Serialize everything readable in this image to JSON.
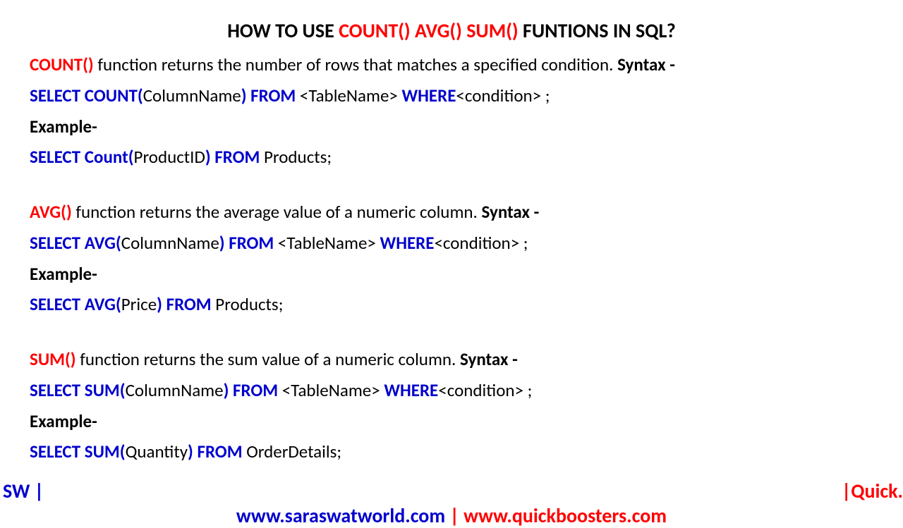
{
  "title": {
    "pre": "HOW TO USE ",
    "mid": "COUNT() AVG() SUM()",
    "post": " FUNTIONS IN SQL?"
  },
  "sections": {
    "count": {
      "fn": "COUNT()",
      "descPre": " function returns the number of rows that matches a specified condition. ",
      "syntaxLabel": "Syntax -",
      "select": "SELECT  ",
      "fnName": "COUNT(",
      "col": "ColumnName",
      "close": ")",
      "from": " FROM",
      "table": " <TableName> ",
      "where": "WHERE",
      "cond": "<condition>  ;",
      "exampleLabel": "Example-",
      "exSelect": "SELECT  ",
      "exFn": "Count(",
      "exCol": "ProductID",
      "exClose": ")",
      "exFrom": " FROM",
      "exRest": " Products;"
    },
    "avg": {
      "fn": "AVG()",
      "descPre": " function returns the average value of a numeric column. ",
      "syntaxLabel": "Syntax -",
      "select": "SELECT  ",
      "fnName": "AVG(",
      "col": "ColumnName",
      "close": ")",
      "from": " FROM",
      "table": " <TableName> ",
      "where": "WHERE",
      "cond": "<condition>  ;",
      "exampleLabel": "Example-",
      "exSelect": "SELECT  ",
      "exFn": "AVG(",
      "exCol": "Price",
      "exClose": ")",
      "exFrom": " FROM",
      "exRest": " Products;"
    },
    "sum": {
      "fn": "SUM()",
      "descPre": " function returns the sum value of a numeric column. ",
      "syntaxLabel": "Syntax -",
      "select": "SELECT  ",
      "fnName": "SUM(",
      "col": "ColumnName",
      "close": ")",
      "from": " FROM",
      "table": " <TableName> ",
      "where": "WHERE",
      "cond": "<condition>  ;",
      "exampleLabel": "Example-",
      "exSelect": "SELECT  ",
      "exFn": "SUM(",
      "exCol": "Quantity",
      "exClose": ")",
      "exFrom": " FROM",
      "exRest": " OrderDetails;"
    }
  },
  "footer": {
    "sw": "SW |",
    "url1": "www.saraswatworld.com",
    "sep": " | ",
    "url2": "www.quickboosters.com",
    "quick": "|Quick."
  }
}
